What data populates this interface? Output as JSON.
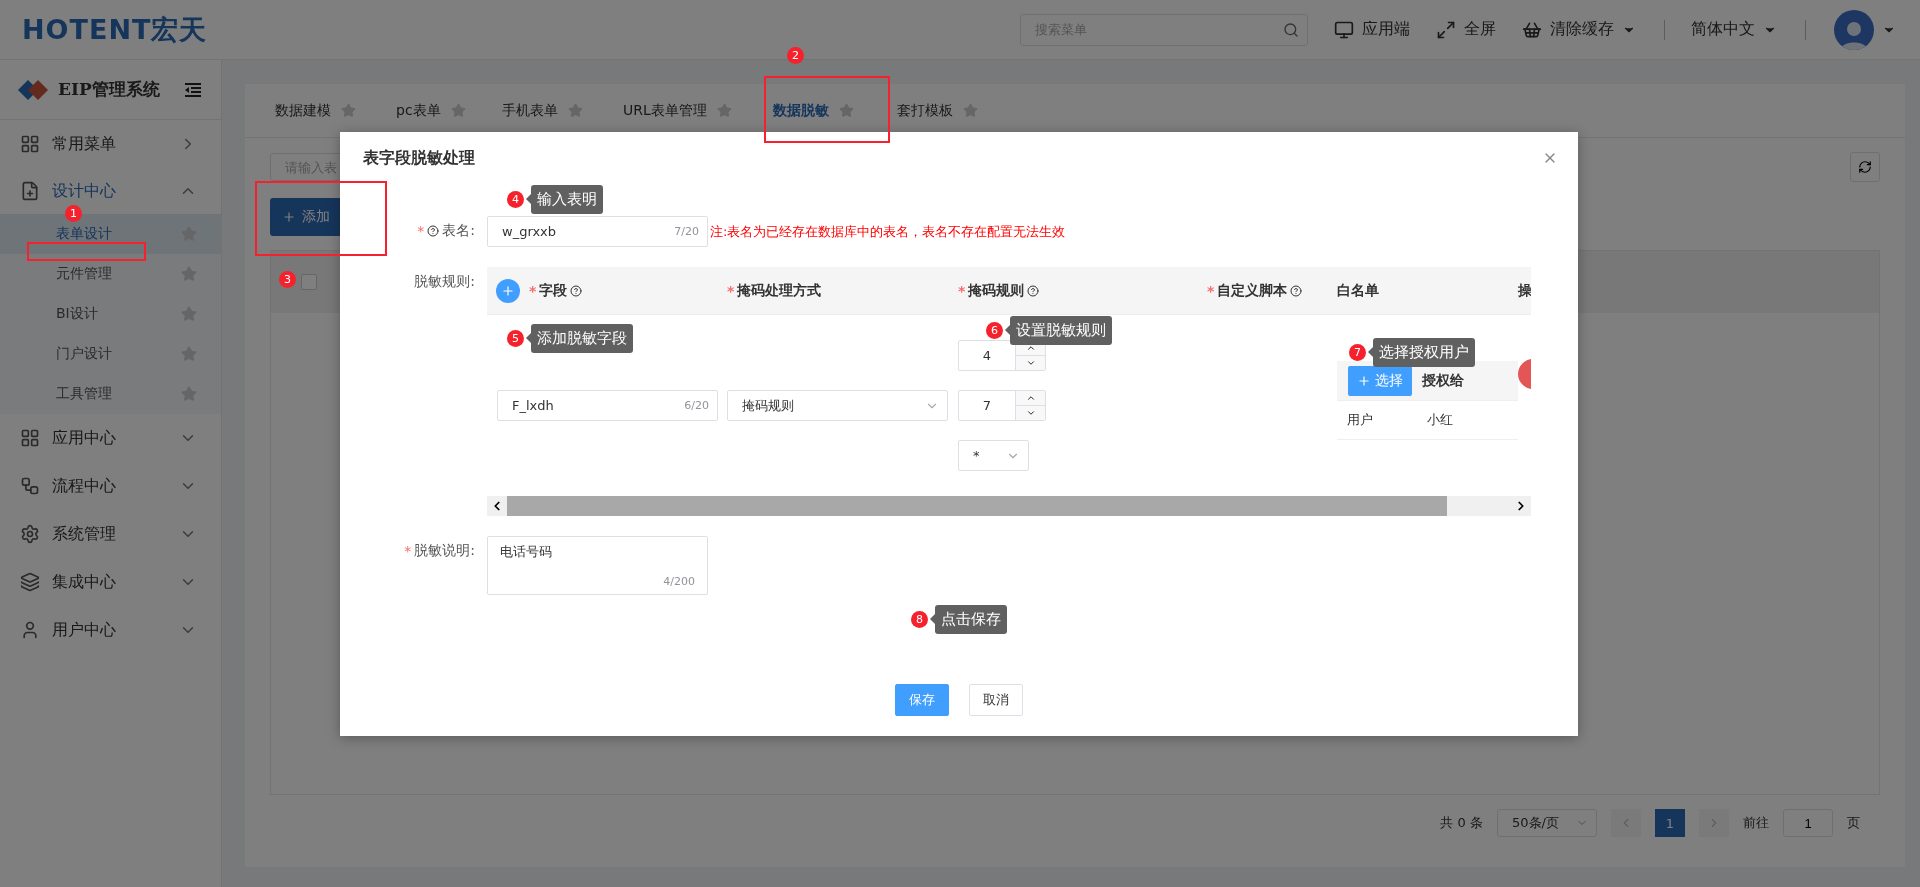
{
  "header": {
    "logo": "HOTENT宏天",
    "search": {
      "placeholder": "搜索菜单"
    },
    "actions": [
      {
        "label": "应用端",
        "kind": "monitor",
        "dropdown": false
      },
      {
        "label": "全屏",
        "kind": "expand",
        "dropdown": false
      },
      {
        "label": "清除缓存",
        "kind": "basket",
        "dropdown": true
      }
    ],
    "language": "简体中文"
  },
  "sidebar": {
    "title": "EIP管理系统",
    "items": [
      {
        "label": "常用菜单",
        "kind": "flyout",
        "expanded": false
      },
      {
        "label": "设计中心",
        "kind": "group",
        "expanded": true,
        "children": [
          {
            "label": "表单设计",
            "selected": true
          },
          {
            "label": "元件管理",
            "selected": false
          },
          {
            "label": "BI设计",
            "selected": false
          },
          {
            "label": "门户设计",
            "selected": false
          },
          {
            "label": "工具管理",
            "selected": false
          }
        ]
      },
      {
        "label": "应用中心",
        "kind": "group",
        "expanded": false
      },
      {
        "label": "流程中心",
        "kind": "group",
        "expanded": false
      },
      {
        "label": "系统管理",
        "kind": "group",
        "expanded": false
      },
      {
        "label": "集成中心",
        "kind": "group",
        "expanded": false
      },
      {
        "label": "用户中心",
        "kind": "group",
        "expanded": false
      }
    ]
  },
  "tabs": [
    {
      "label": "数据建模",
      "selected": false
    },
    {
      "label": "pc表单",
      "selected": false
    },
    {
      "label": "手机表单",
      "selected": false
    },
    {
      "label": "URL表单管理",
      "selected": false
    },
    {
      "label": "数据脱敏",
      "selected": true
    },
    {
      "label": "套打模板",
      "selected": false
    }
  ],
  "content": {
    "search": {
      "placeholder": "请输入表"
    },
    "add_button": "添加",
    "select_all": {
      "checked": false
    },
    "pagination": {
      "total": "共 0 条",
      "page_size": "50条/页",
      "pages": [
        {
          "label": "1",
          "selected": true
        }
      ],
      "goto_label": "前往",
      "goto_value": "1",
      "page_unit": "页"
    }
  },
  "dialog": {
    "title": "表字段脱敏处理",
    "name_field": {
      "label": "表名:",
      "required": true,
      "value": "w_grxxb",
      "count": "7/20",
      "note": "注:表名为已经存在数据库中的表名，表名不存在配置无法生效",
      "callout": {
        "number": "4",
        "text": "输入表明"
      }
    },
    "rules": {
      "label": "脱敏规则:",
      "columns": [
        {
          "label": "字段",
          "required": true,
          "help": true
        },
        {
          "label": "掩码处理方式",
          "required": true,
          "help": false
        },
        {
          "label": "掩码规则",
          "required": true,
          "help": true
        },
        {
          "label": "自定义脚本",
          "required": true,
          "help": true
        },
        {
          "label": "白名单",
          "required": false,
          "help": false
        },
        {
          "label": "操",
          "required": false,
          "help": false
        }
      ],
      "add_callout": {
        "number": "5",
        "text": "添加脱敏字段"
      },
      "rule_callout": {
        "number": "6",
        "text": "设置脱敏规则"
      },
      "whitelist_callout": {
        "number": "7",
        "text": "选择授权用户"
      },
      "rows": [
        {
          "field": {
            "value": "F_lxdh",
            "count": "6/20"
          },
          "method": "掩码规则",
          "numbers": [
            "4",
            "7"
          ],
          "mask_char": "*",
          "whitelist": {
            "button": "选择",
            "header": "授权给",
            "entries": [
              {
                "type": "用户",
                "name": "小红"
              }
            ]
          }
        }
      ]
    },
    "description": {
      "label": "脱敏说明:",
      "required": true,
      "value": "电话号码",
      "count": "4/200"
    },
    "save_callout": {
      "number": "8",
      "text": "点击保存"
    },
    "buttons": [
      {
        "label": "保存",
        "kind": "primary"
      },
      {
        "label": "取消",
        "kind": "default"
      }
    ]
  },
  "annotations": [
    {
      "number": "1"
    },
    {
      "number": "2"
    },
    {
      "number": "3"
    }
  ]
}
